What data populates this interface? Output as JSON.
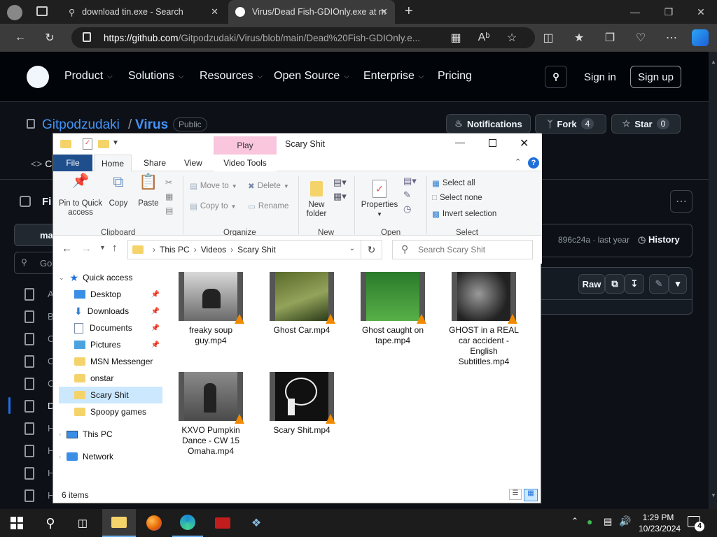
{
  "browser": {
    "tabs": [
      {
        "title": "download tin.exe - Search"
      },
      {
        "title": "Virus/Dead Fish-GDIOnly.exe at m"
      }
    ],
    "new_tab": "+",
    "url_host": "https://github.com",
    "url_path": "/Gitpodzudaki/Virus/blob/main/Dead%20Fish-GDIOnly.e..."
  },
  "github": {
    "nav": [
      "Product",
      "Solutions",
      "Resources",
      "Open Source",
      "Enterprise",
      "Pricing"
    ],
    "sign_in": "Sign in",
    "sign_up": "Sign up",
    "owner": "Gitpodzudaki",
    "slash": "/",
    "repo": "Virus",
    "visibility": "Public",
    "notifications": "Notifications",
    "fork": "Fork",
    "fork_count": "4",
    "star": "Star",
    "star_count": "0",
    "code_tab_char": "C",
    "files_char": "Fi",
    "branch_char": "ma",
    "goto_char": "Go",
    "commit": "896c24a · last year",
    "history": "History",
    "raw": "Raw",
    "file_chars": [
      "A",
      "B",
      "C",
      "C",
      "C",
      "D",
      "H",
      "H",
      "H",
      "H"
    ]
  },
  "explorer": {
    "title": "Scary Shit",
    "context_tab": "Play",
    "tabs": [
      "File",
      "Home",
      "Share",
      "View",
      "Video Tools"
    ],
    "clipboard": {
      "pin": "Pin to Quick access",
      "copy": "Copy",
      "paste": "Paste",
      "group": "Clipboard"
    },
    "organize": {
      "move_to": "Move to",
      "copy_to": "Copy to",
      "delete": "Delete",
      "rename": "Rename",
      "group": "Organize"
    },
    "new": {
      "new_folder": "New folder",
      "group": "New"
    },
    "open": {
      "properties": "Properties",
      "group": "Open"
    },
    "select": {
      "select_all": "Select all",
      "select_none": "Select none",
      "invert": "Invert selection",
      "group": "Select"
    },
    "path": [
      "This PC",
      "Videos",
      "Scary Shit"
    ],
    "search_placeholder": "Search Scary Shit",
    "nav": {
      "quick_access": "Quick access",
      "items": [
        "Desktop",
        "Downloads",
        "Documents",
        "Pictures",
        "MSN Messenger",
        "onstar",
        "Scary Shit",
        "Spoopy games"
      ],
      "this_pc": "This PC",
      "network": "Network"
    },
    "files": [
      "freaky soup guy.mp4",
      "Ghost Car.mp4",
      "Ghost caught on tape.mp4",
      "GHOST in a REAL car accident - English Subtitles.mp4",
      "KXVO Pumpkin Dance - CW 15 Omaha.mp4",
      "Scary Shit.mp4"
    ],
    "status": "6 items"
  },
  "taskbar": {
    "time": "1:29 PM",
    "date": "10/23/2024",
    "notif_count": "4"
  },
  "colors": {
    "accent": "#0078d4",
    "file_tab": "#1e4e8c",
    "context_tab": "#f9c6dd",
    "folder": "#f5d36b"
  }
}
